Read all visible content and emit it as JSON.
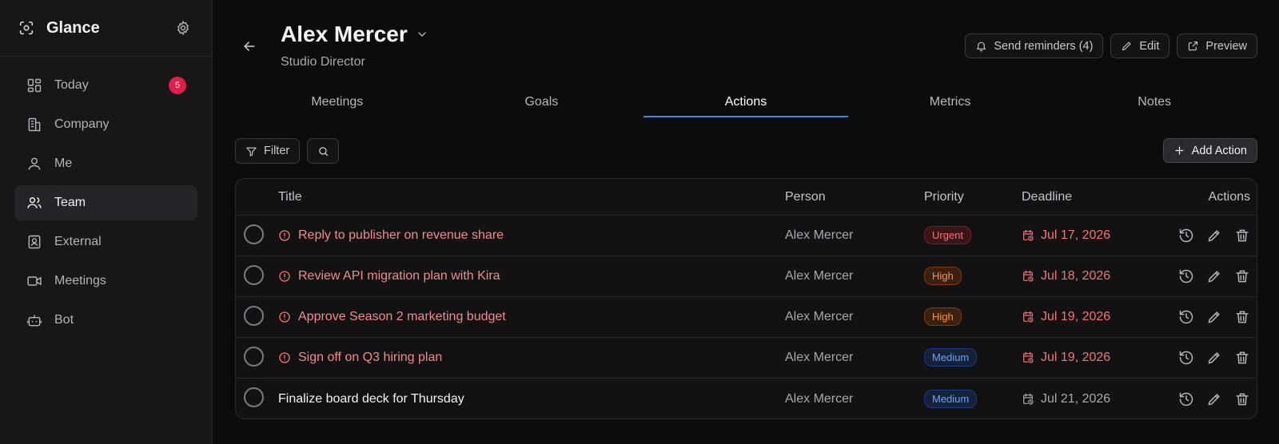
{
  "app": {
    "name": "Glance"
  },
  "sidebar": {
    "items": [
      {
        "label": "Today",
        "icon": "dashboard-icon",
        "badge": "5",
        "active": false
      },
      {
        "label": "Company",
        "icon": "building-icon",
        "active": false
      },
      {
        "label": "Me",
        "icon": "user-icon",
        "active": false
      },
      {
        "label": "Team",
        "icon": "users-icon",
        "active": true
      },
      {
        "label": "External",
        "icon": "contact-card-icon",
        "active": false
      },
      {
        "label": "Meetings",
        "icon": "video-icon",
        "active": false
      },
      {
        "label": "Bot",
        "icon": "bot-icon",
        "active": false
      }
    ]
  },
  "header": {
    "name": "Alex Mercer",
    "role": "Studio Director",
    "send_reminders": "Send reminders (4)",
    "edit": "Edit",
    "preview": "Preview"
  },
  "tabs": [
    {
      "label": "Meetings",
      "active": false
    },
    {
      "label": "Goals",
      "active": false
    },
    {
      "label": "Actions",
      "active": true
    },
    {
      "label": "Metrics",
      "active": false
    },
    {
      "label": "Notes",
      "active": false
    }
  ],
  "toolbar": {
    "filter": "Filter",
    "add_action": "Add Action"
  },
  "table": {
    "columns": {
      "title": "Title",
      "person": "Person",
      "priority": "Priority",
      "deadline": "Deadline",
      "actions": "Actions"
    },
    "rows": [
      {
        "title": "Reply to publisher on revenue share",
        "person": "Alex Mercer",
        "priority": "Urgent",
        "deadline": "Jul 17, 2026",
        "overdue": true
      },
      {
        "title": "Review API migration plan with Kira",
        "person": "Alex Mercer",
        "priority": "High",
        "deadline": "Jul 18, 2026",
        "overdue": true
      },
      {
        "title": "Approve Season 2 marketing budget",
        "person": "Alex Mercer",
        "priority": "High",
        "deadline": "Jul 19, 2026",
        "overdue": true
      },
      {
        "title": "Sign off on Q3 hiring plan",
        "person": "Alex Mercer",
        "priority": "Medium",
        "deadline": "Jul 19, 2026",
        "overdue": true
      },
      {
        "title": "Finalize board deck for Thursday",
        "person": "Alex Mercer",
        "priority": "Medium",
        "deadline": "Jul 21, 2026",
        "overdue": false
      }
    ]
  },
  "colors": {
    "accent": "#3b82f6",
    "badge": "#e11d48",
    "overdue": "#f87171"
  }
}
